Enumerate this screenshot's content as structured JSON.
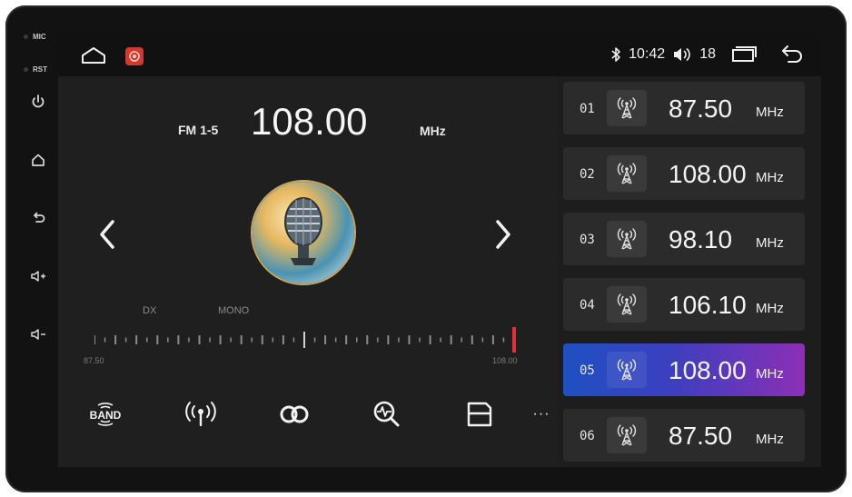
{
  "side": {
    "mic_label": "MIC",
    "rst_label": "RST"
  },
  "status": {
    "time": "10:42",
    "volume": "18"
  },
  "radio": {
    "band": "FM 1-5",
    "frequency": "108.00",
    "unit": "MHz",
    "dx_label": "DX",
    "mono_label": "MONO",
    "scale_min": "87.50",
    "scale_max": "108.00",
    "tuner_position_fraction": 1.0
  },
  "toolbar": {
    "band_label": "BAND",
    "more_label": "···"
  },
  "presets": [
    {
      "num": "01",
      "freq": "87.50",
      "unit": "MHz",
      "active": false
    },
    {
      "num": "02",
      "freq": "108.00",
      "unit": "MHz",
      "active": false
    },
    {
      "num": "03",
      "freq": "98.10",
      "unit": "MHz",
      "active": false
    },
    {
      "num": "04",
      "freq": "106.10",
      "unit": "MHz",
      "active": false
    },
    {
      "num": "05",
      "freq": "108.00",
      "unit": "MHz",
      "active": true
    },
    {
      "num": "06",
      "freq": "87.50",
      "unit": "MHz",
      "active": false
    }
  ],
  "colors": {
    "active_gradient_start": "#1f50c2",
    "active_gradient_end": "#8c2fb6",
    "tuner_marker": "#e0303a",
    "app_badge": "#d23a2f"
  },
  "icons": {
    "side": [
      "power-icon",
      "home-icon",
      "back-icon",
      "volume-up-icon",
      "volume-down-icon"
    ],
    "status": [
      "bluetooth-icon",
      "speaker-icon",
      "recent-apps-icon",
      "back-arrow-icon"
    ],
    "toolbar": [
      "band-icon",
      "antenna-icon",
      "stereo-icon",
      "scan-icon",
      "save-icon",
      "more-icon"
    ]
  }
}
